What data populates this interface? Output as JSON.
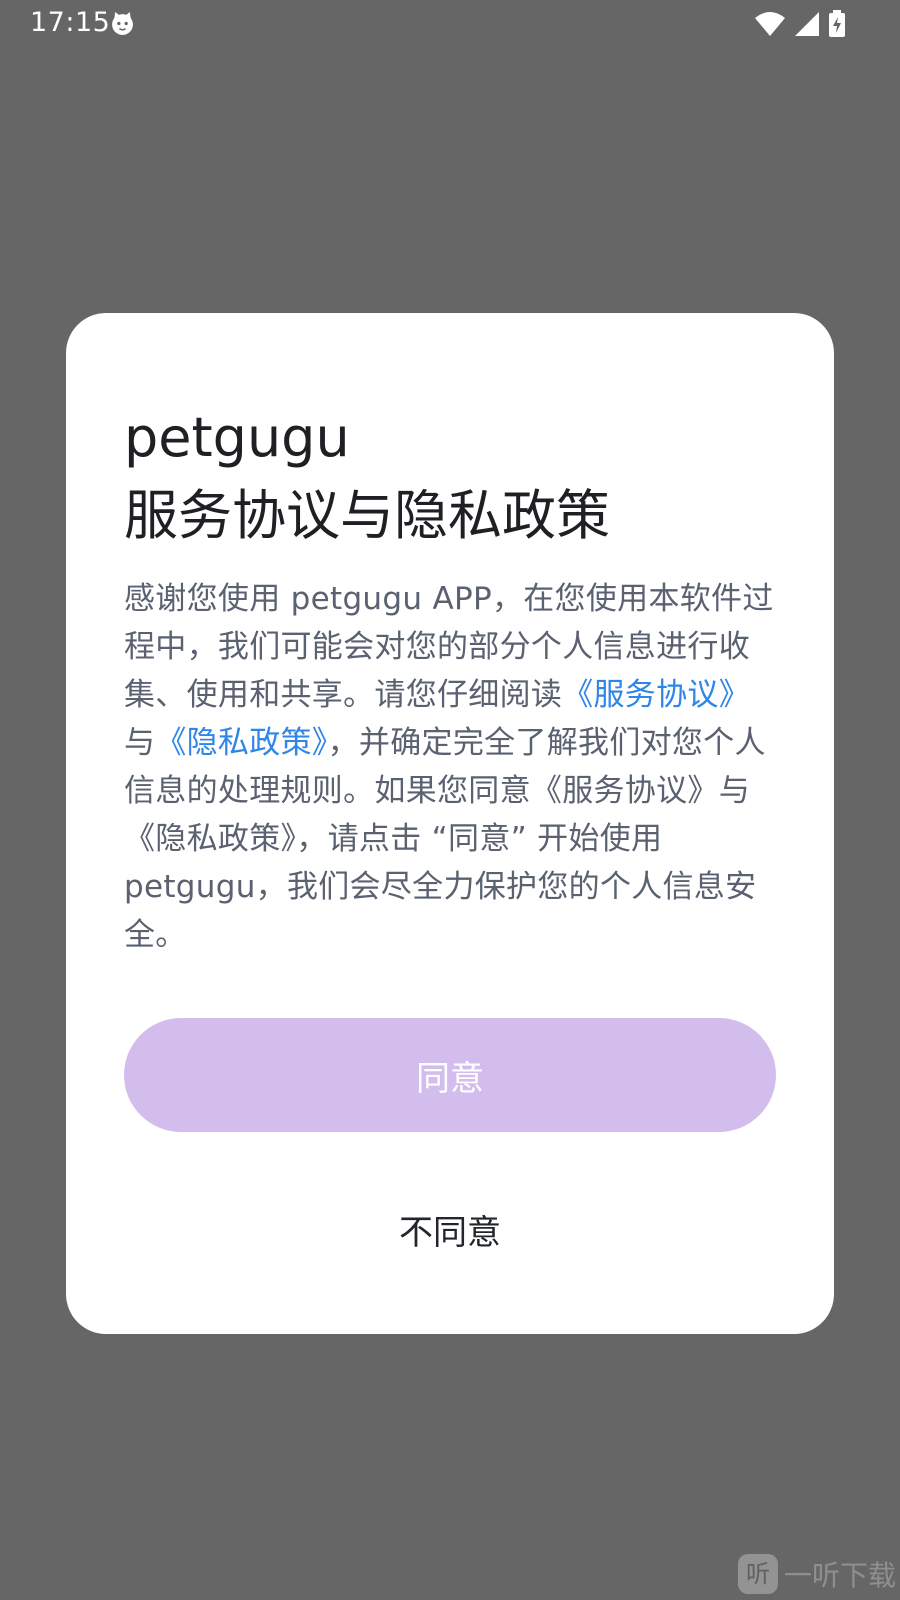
{
  "status_bar": {
    "time": "17:15",
    "icons": [
      "cat-face-icon",
      "wifi-icon",
      "cellular-signal-icon",
      "battery-charging-icon"
    ]
  },
  "dialog": {
    "title_line1": "petgugu",
    "title_line2": "服务协议与隐私政策",
    "body": {
      "part1": "感谢您使用 petgugu APP，在您使用本软件过程中，我们可能会对您的部分个人信息进行收集、使用和共享。请您仔细阅读",
      "link_service": "《服务协议》",
      "conjunction": "与",
      "link_privacy": "《隐私政策》",
      "part2": "，并确定完全了解我们对您个人信息的处理规则。如果您同意《服务协议》与《隐私政策》，请点击 “同意” 开始使用 petgugu，我们会尽全力保护您的个人信息安全。"
    },
    "agree_label": "同意",
    "disagree_label": "不同意"
  },
  "watermark": {
    "logo_char": "听",
    "text": "一听下载"
  },
  "colors": {
    "backdrop": "#666666",
    "dialog_bg": "#ffffff",
    "link": "#2f86e8",
    "agree_button": "#d2bdec",
    "body_text": "#5a6170",
    "title_text": "#1f1f24"
  }
}
